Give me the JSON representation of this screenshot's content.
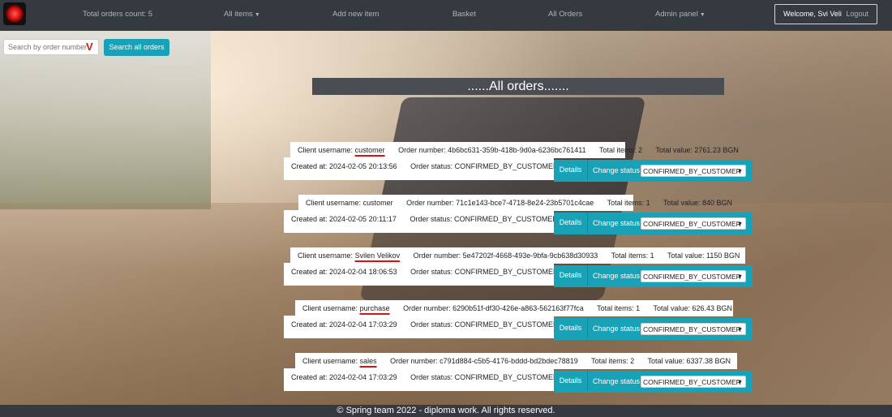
{
  "navbar": {
    "total_orders": "Total orders count: 5",
    "all_items": "All items",
    "add_new_item": "Add new item",
    "basket": "Basket",
    "all_orders": "All Orders",
    "admin_panel": "Admin panel",
    "welcome": "Welcome, Svi Veli",
    "logout": "Logout"
  },
  "search": {
    "placeholder": "Search by order number",
    "button": "Search all orders"
  },
  "page_title": "......All orders.......",
  "orders": [
    {
      "client_label": "Client username:",
      "client": "customer",
      "order_number": "Order number: 4b6bc631-359b-418b-9d0a-6236bc761411",
      "total_items": "Total items: 2",
      "total_value": "Total value: 2761.23 BGN",
      "created_at": "Created at: 2024-02-05 20:13:56",
      "status": "Order status: CONFIRMED_BY_CUSTOMER",
      "details": "Details",
      "change_status": "Change status",
      "selected_status": "CONFIRMED_BY_CUSTOMER"
    },
    {
      "client_label": "Client username:",
      "client": "customer",
      "order_number": "Order number: 71c1e143-bce7-4718-8e24-23b5701c4cae",
      "total_items": "Total items: 1",
      "total_value": "Total value: 840 BGN",
      "created_at": "Created at: 2024-02-05 20:11:17",
      "status": "Order status: CONFIRMED_BY_CUSTOMER",
      "details": "Details",
      "change_status": "Change status",
      "selected_status": "CONFIRMED_BY_CUSTOMER"
    },
    {
      "client_label": "Client username:",
      "client": "Svilen Velikov",
      "order_number": "Order number: 5e47202f-4668-493e-9bfa-9cb638d30933",
      "total_items": "Total items: 1",
      "total_value": "Total value: 1150 BGN",
      "created_at": "Created at: 2024-02-04 18:06:53",
      "status": "Order status: CONFIRMED_BY_CUSTOMER",
      "details": "Details",
      "change_status": "Change status",
      "selected_status": "CONFIRMED_BY_CUSTOMER"
    },
    {
      "client_label": "Client username:",
      "client": "purchase",
      "order_number": "Order number: 6290b51f-df30-426e-a863-562163f77fca",
      "total_items": "Total items: 1",
      "total_value": "Total value: 626.43 BGN",
      "created_at": "Created at: 2024-02-04 17:03:29",
      "status": "Order status: CONFIRMED_BY_CUSTOMER",
      "details": "Details",
      "change_status": "Change status",
      "selected_status": "CONFIRMED_BY_CUSTOMER"
    },
    {
      "client_label": "Client username:",
      "client": "sales",
      "order_number": "Order number: c791d884-c5b5-4176-bddd-bd2bdec78819",
      "total_items": "Total items: 2",
      "total_value": "Total value: 6337.38 BGN",
      "created_at": "Created at: 2024-02-04 17:03:29",
      "status": "Order status: CONFIRMED_BY_CUSTOMER",
      "details": "Details",
      "change_status": "Change status",
      "selected_status": "CONFIRMED_BY_CUSTOMER"
    }
  ],
  "footer": "© Spring team 2022 - diploma work. All rights reserved."
}
